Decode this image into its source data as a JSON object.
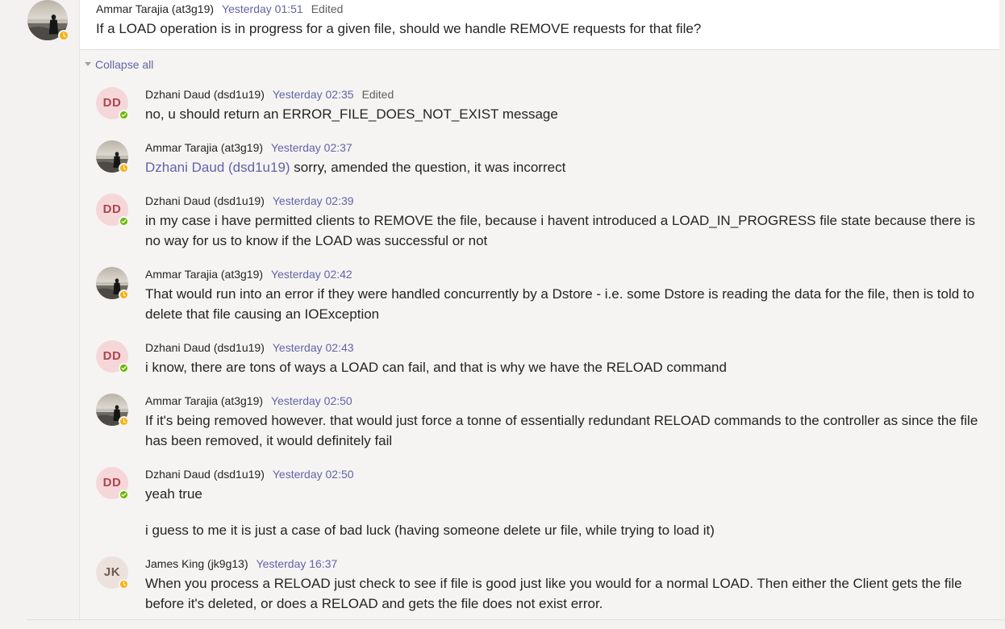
{
  "root": {
    "author": "Ammar Tarajia (at3g19)",
    "time": "Yesterday 01:51",
    "edited": "Edited",
    "text": "If a LOAD operation is in progress for a given file, should we handle REMOVE requests for that file?"
  },
  "collapse_label": "Collapse all",
  "replies": [
    {
      "author": "Dzhani Daud (dsd1u19)",
      "time": "Yesterday 02:35",
      "edited": "Edited",
      "initials": "DD",
      "text": "no, u should return an ERROR_FILE_DOES_NOT_EXIST message"
    },
    {
      "author": "Ammar Tarajia (at3g19)",
      "time": "Yesterday 02:37",
      "mention": "Dzhani Daud (dsd1u19)",
      "text": " sorry, amended the question, it was incorrect"
    },
    {
      "author": "Dzhani Daud (dsd1u19)",
      "time": "Yesterday 02:39",
      "initials": "DD",
      "text": "in my case i have permitted clients to REMOVE the file, because i havent introduced a LOAD_IN_PROGRESS file state because there is no way for us to know if the LOAD was successful or not"
    },
    {
      "author": "Ammar Tarajia (at3g19)",
      "time": "Yesterday 02:42",
      "text": "That would run into an error if they were handled concurrently by a Dstore - i.e. some Dstore is reading the data for the file, then is told to delete that file causing an IOException"
    },
    {
      "author": "Dzhani Daud (dsd1u19)",
      "time": "Yesterday 02:43",
      "initials": "DD",
      "text": "i know, there are tons of ways a LOAD can fail, and that is why we have the RELOAD command"
    },
    {
      "author": "Ammar Tarajia (at3g19)",
      "time": "Yesterday 02:50",
      "text": "If it's being removed however. that would just force a tonne of essentially redundant RELOAD commands to the controller as since the file has been removed, it would definitely fail"
    },
    {
      "author": "Dzhani Daud (dsd1u19)",
      "time": "Yesterday 02:50",
      "initials": "DD",
      "text": "yeah true",
      "text2": "i guess to me it is just a case of bad luck (having someone delete ur file, while trying to load it)"
    },
    {
      "author": "James King (jk9g13)",
      "time": "Yesterday 16:37",
      "initials": "JK",
      "text": "When you process a RELOAD just check to see if file is good just like you would for a normal LOAD. Then either the Client gets the file before it's deleted, or does a RELOAD and gets the file does not exist error."
    }
  ],
  "colors": {
    "accent": "#6264a7",
    "away": "#f8b00a",
    "available": "#6bb700"
  },
  "icons": {
    "away": "clock-icon",
    "available": "check-icon"
  }
}
